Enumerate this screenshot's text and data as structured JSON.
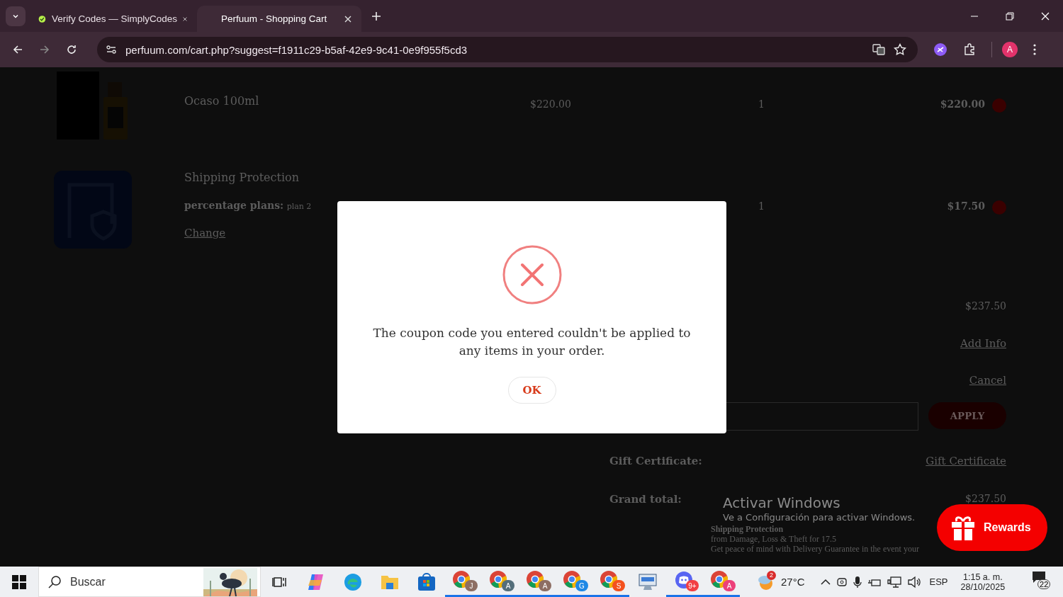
{
  "browser": {
    "tabs": [
      {
        "title": "Verify Codes — SimplyCodes",
        "selected": false,
        "kind": "simplycodes"
      },
      {
        "title": "Perfuum - Shopping Cart",
        "selected": true,
        "kind": "blank"
      }
    ],
    "url": "perfuum.com/cart.php?suggest=f1911c29-b5af-42e9-9c41-0e9f955f5cd3",
    "profile_letter": "A"
  },
  "cart": {
    "items": [
      {
        "name": "Ocaso 100ml",
        "price": "$220.00",
        "quantity": "1",
        "total": "$220.00",
        "kind": "perfume"
      },
      {
        "name": "Shipping Protection",
        "plan_label": "percentage plans:",
        "plan": "plan 2",
        "change_link": "Change",
        "quantity": "1",
        "total": "$17.50",
        "kind": "protection"
      }
    ],
    "summary": {
      "subtotal": "$237.50",
      "add_info": "Add Info",
      "cancel": "Cancel",
      "apply": "APPLY",
      "gift_label": "Gift Certificate:",
      "gift_link": "Gift Certificate",
      "grand_label": "Grand total:",
      "grand_total": "$237.50"
    },
    "protection_note": [
      "Shipping Protection",
      "from Damage, Loss & Theft for 17.5",
      "Get peace of mind with Delivery Guarantee in the event your"
    ]
  },
  "dialog": {
    "message": "The coupon code you entered couldn't be applied to any items in your order.",
    "button": "OK"
  },
  "rewards_button": "Rewards",
  "activation_notice": {
    "title": "Activar Windows",
    "text": "Ve a Configuración para activar Windows."
  },
  "taskbar": {
    "search_placeholder": "Buscar",
    "apps": [
      {
        "kind": "taskview",
        "running": false
      },
      {
        "kind": "copilot",
        "running": false
      },
      {
        "kind": "edge",
        "running": false
      },
      {
        "kind": "folder",
        "running": false
      },
      {
        "kind": "store",
        "running": false
      },
      {
        "kind": "chrome",
        "badge": "J",
        "color": "#8d6e63",
        "running": true
      },
      {
        "kind": "chrome",
        "badge": "A",
        "color": "#546e7a",
        "running": true
      },
      {
        "kind": "chrome",
        "badge": "A",
        "color": "#8d6e63",
        "running": true
      },
      {
        "kind": "chrome",
        "badge": "G",
        "color": "#1e88e5",
        "running": true
      },
      {
        "kind": "chrome",
        "badge": "S",
        "color": "#f4511e",
        "running": true
      },
      {
        "kind": "monitor",
        "running": false
      },
      {
        "kind": "discord",
        "badge": "9+",
        "color": "#f23f43",
        "running": true
      },
      {
        "kind": "chrome",
        "badge": "A",
        "color": "#ec407a",
        "running": true
      }
    ],
    "weather_badge": "2",
    "temperature": "27°C",
    "language": "ESP",
    "time": "1:15 a. m.",
    "date": "28/10/2025",
    "notifications": "22"
  }
}
